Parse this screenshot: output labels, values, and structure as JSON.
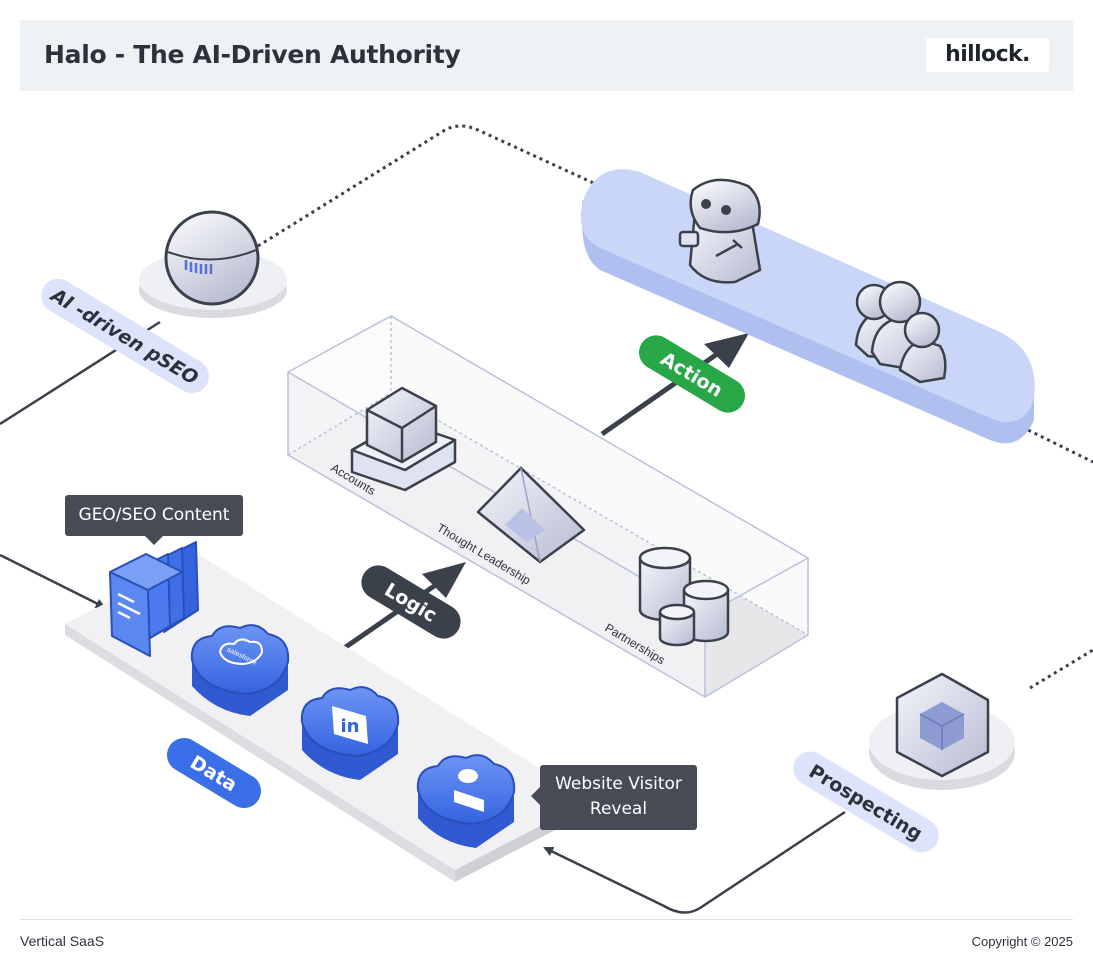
{
  "header": {
    "title": "Halo - The AI-Driven Authority",
    "logo_text": "hillock."
  },
  "pills": {
    "ai_pseo": "AI -driven pSEO",
    "action": "Action",
    "logic": "Logic",
    "data": "Data",
    "prospecting": "Prospecting"
  },
  "callouts": {
    "geo_seo": "GEO/SEO Content",
    "website_visitor": "Website Visitor Reveal"
  },
  "box_labels": {
    "accounts": "Accounts",
    "thought_leadership": "Thought Leadership",
    "partnerships": "Partnerships"
  },
  "platform_labels": {
    "salesforce": "salesforce"
  },
  "colors": {
    "blue": "#3b6fe8",
    "green": "#27a745",
    "dark": "#3b414b",
    "lavender": "#c9d6f8",
    "pill_lavender": "#dde3fa"
  },
  "footer": {
    "left": "Vertical SaaS",
    "right": "Copyright © 2025"
  }
}
